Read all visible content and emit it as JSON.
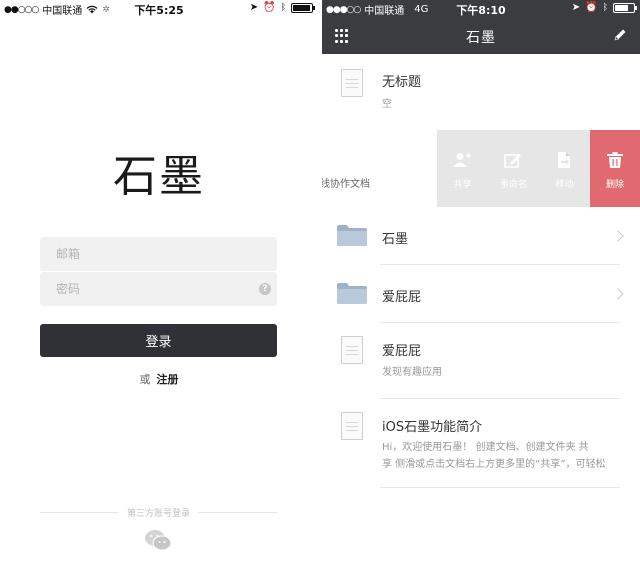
{
  "left_screen": {
    "status_bar": {
      "carrier": "中国联通",
      "time": "下午5:25"
    },
    "logo": "石墨",
    "email_placeholder": "邮箱",
    "password_placeholder": "密码",
    "help_symbol": "?",
    "login_label": "登录",
    "or_label": "或",
    "register_label": "注册",
    "third_party_label": "第三方账号登录"
  },
  "right_screen": {
    "status_bar": {
      "carrier": "中国联通",
      "network": "4G",
      "time": "下午8:10"
    },
    "nav_title": "石墨",
    "items": [
      {
        "type": "doc",
        "name": "无标题",
        "subtitle": "空"
      },
      {
        "type": "doc",
        "name": "线协作文档"
      },
      {
        "type": "folder",
        "name": "石墨"
      },
      {
        "type": "folder",
        "name": "爱屁屁"
      },
      {
        "type": "doc",
        "name": "爱屁屁",
        "subtitle": "发现有趣应用"
      },
      {
        "type": "doc",
        "name": "iOS石墨功能简介",
        "subtitle_line1": "Hi，欢迎使用石墨！      创建文档、创建文件夹    共",
        "subtitle_line2": "享 侧滑或点击文档右上方更多里的“共享”，可轻松"
      }
    ],
    "swipe_actions": [
      {
        "name": "share",
        "label": "共享"
      },
      {
        "name": "rename",
        "label": "重命名"
      },
      {
        "name": "move",
        "label": "移动"
      },
      {
        "name": "delete",
        "label": "删除"
      }
    ],
    "colors": {
      "nav_bar": "#3a3c40",
      "delete": "#e06a6f",
      "action_gray": "#e6e6e6"
    }
  }
}
